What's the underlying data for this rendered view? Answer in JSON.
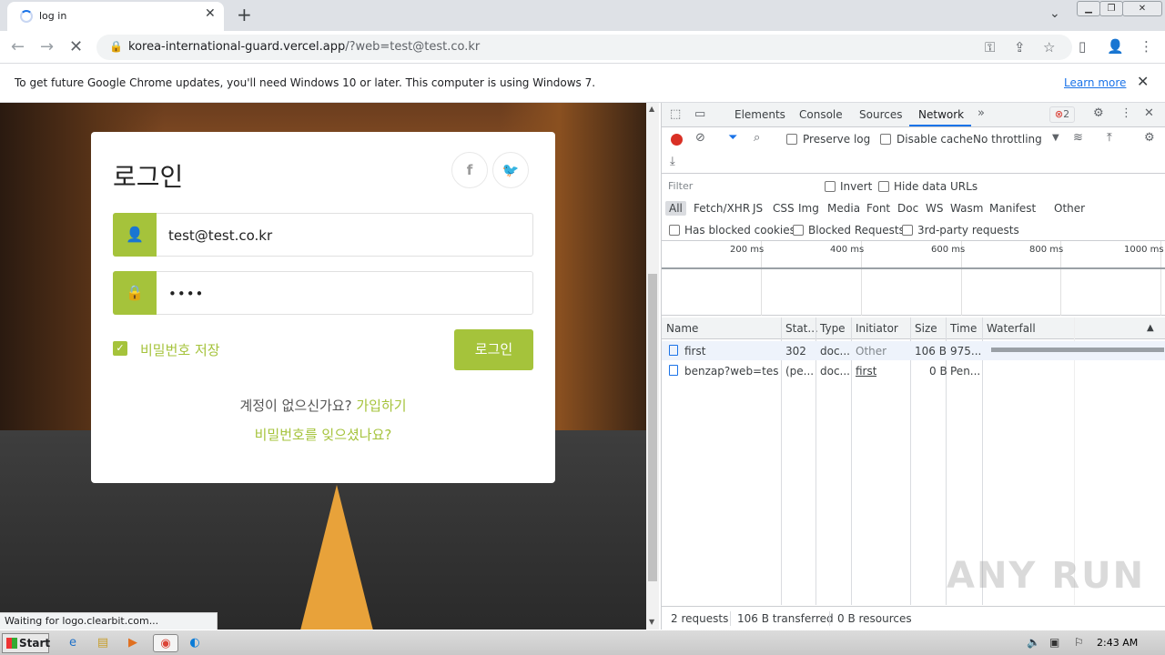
{
  "browser": {
    "tab_title": "log in",
    "url_host": "korea-international-guard.vercel.app",
    "url_path": "/?web=test@test.co.kr",
    "infobar_message": "To get future Google Chrome updates, you'll need Windows 10 or later. This computer is using Windows 7.",
    "infobar_link": "Learn more",
    "status_text": "Waiting for logo.clearbit.com..."
  },
  "login": {
    "heading": "로그인",
    "social": [
      "f",
      "🐦"
    ],
    "email_value": "test@test.co.kr",
    "password_value": "••••",
    "remember_label": "비밀번호 저장",
    "remember_checked": true,
    "button_label": "로그인",
    "signup_question": "계정이 없으신가요?",
    "signup_link": "가입하기",
    "forgot_link": "비밀번호를 잊으셨나요?",
    "accent_color": "#a5c33b"
  },
  "devtools": {
    "tabs": [
      "Elements",
      "Console",
      "Sources",
      "Network"
    ],
    "active_tab": "Network",
    "error_count": "2",
    "preserve_log": "Preserve log",
    "disable_cache": "Disable cache",
    "throttling": "No throttling",
    "filter_placeholder": "Filter",
    "invert": "Invert",
    "hide_data_urls": "Hide data URLs",
    "type_filters": [
      "All",
      "Fetch/XHR",
      "JS",
      "CSS",
      "Img",
      "Media",
      "Font",
      "Doc",
      "WS",
      "Wasm",
      "Manifest",
      "Other"
    ],
    "has_blocked_cookies": "Has blocked cookies",
    "blocked_requests": "Blocked Requests",
    "third_party": "3rd-party requests",
    "timeline_ticks": [
      "200 ms",
      "400 ms",
      "600 ms",
      "800 ms",
      "1000 ms"
    ],
    "columns": [
      "Name",
      "Stat...",
      "Type",
      "Initiator",
      "Size",
      "Time",
      "Waterfall"
    ],
    "rows": [
      {
        "name": "first",
        "status": "302",
        "type": "doc...",
        "initiator": "Other",
        "size": "106 B",
        "time": "975..."
      },
      {
        "name": "benzap?web=tes...",
        "status": "(pe...",
        "type": "doc...",
        "initiator": "first",
        "size": "0 B",
        "time": "Pen..."
      }
    ],
    "status_requests": "2 requests",
    "status_transferred": "106 B transferred",
    "status_resources": "0 B resources"
  },
  "watermark": "ANY RUN",
  "taskbar": {
    "start_label": "Start",
    "clock": "2:43 AM"
  }
}
